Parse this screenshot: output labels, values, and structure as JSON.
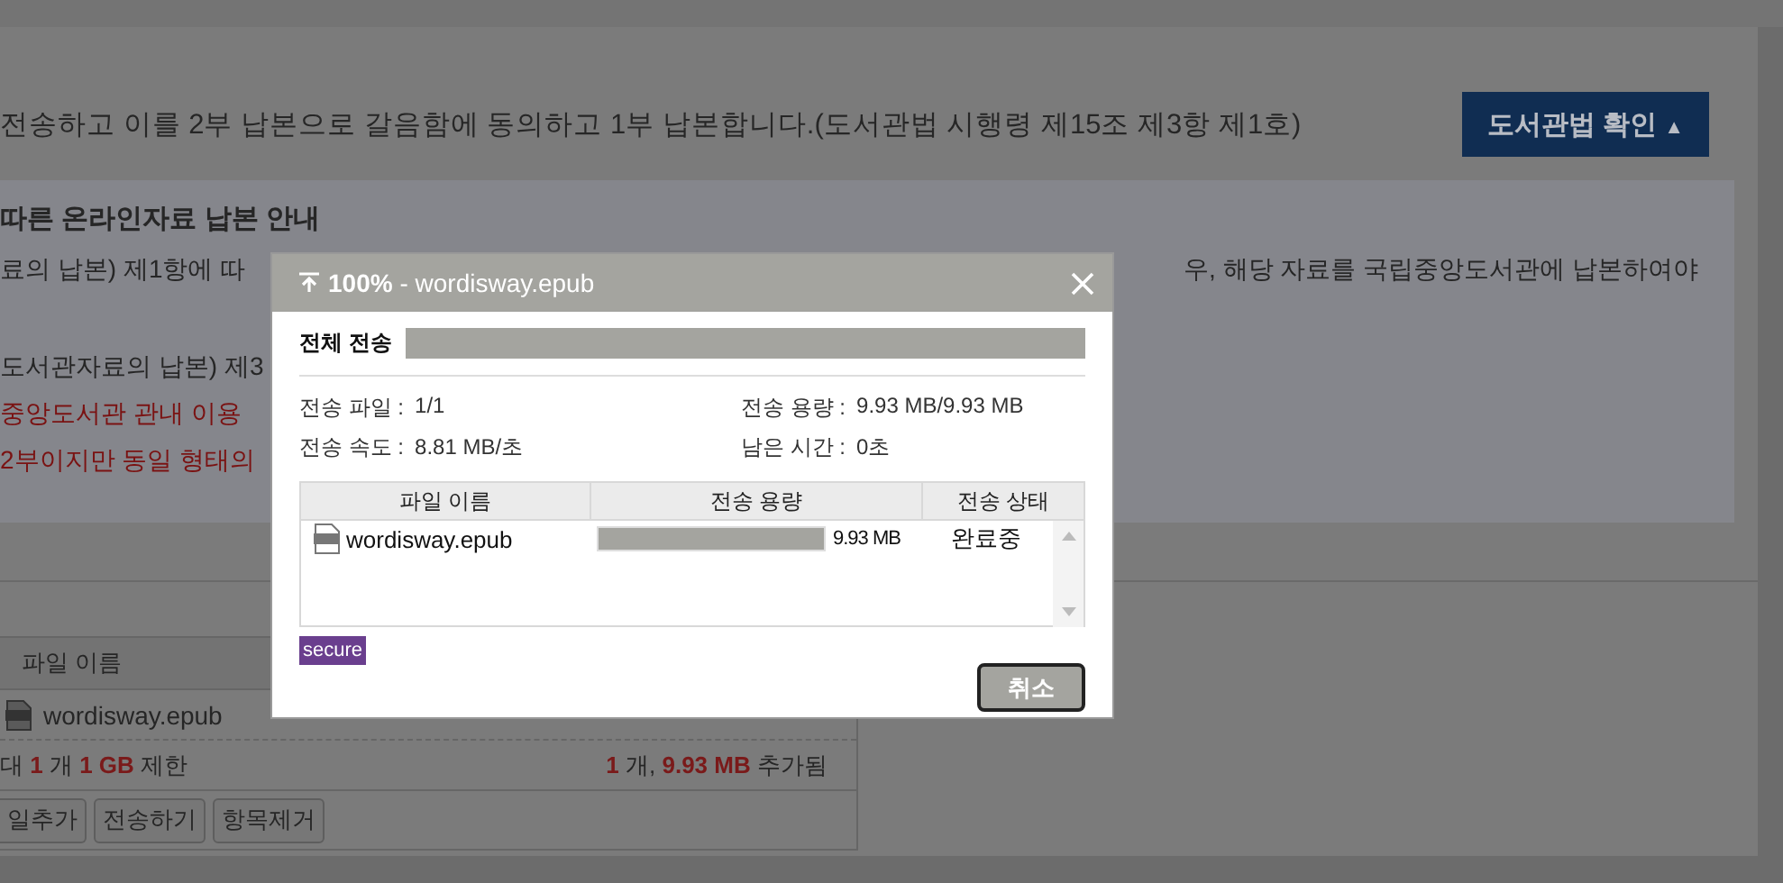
{
  "notice": {
    "text": "전송하고 이를 2부 납본으로 갈음함에 동의하고 1부 납본합니다.(도서관법 시행령 제15조 제3항 제1호)",
    "button": "도서관법 확인",
    "button_icon": "▲"
  },
  "guide": {
    "title": "따른 온라인자료 납본 안내",
    "lines": [
      {
        "kind": "normal",
        "left": "료의 납본) 제1항에 따",
        "right": "우, 해당 자료를 국립중앙도서관에 납본하여야"
      },
      {
        "kind": "gap"
      },
      {
        "kind": "normal",
        "left": "도서관자료의 납본) 제3"
      },
      {
        "kind": "alert",
        "left": "중앙도서관 관내 이용"
      },
      {
        "kind": "alert",
        "left": "2부이지만 동일 형태의"
      }
    ]
  },
  "file_panel": {
    "column": "파일 이름",
    "files": [
      {
        "name": "wordisway.epub"
      }
    ],
    "limit": "대 **1** 개 **1 GB** 제한",
    "added": "**1** 개, **9.93 MB** 추가됨",
    "buttons": [
      "일추가",
      "전송하기",
      "항목제거"
    ]
  },
  "dialog": {
    "title": "**100%** - wordisway.epub",
    "total_label": "전체 전송",
    "total_progress": {
      "level": 1
    },
    "stats": [
      {
        "label": "전송 파일 :",
        "value": "1/1"
      },
      {
        "label": "전송 용량 :",
        "value": "9.93 MB/9.93 MB"
      },
      {
        "label": "전송 속도 :",
        "value": "8.81 MB/초"
      },
      {
        "label": "남은 시간 :",
        "value": "0초"
      }
    ],
    "columns": [
      "파일 이름",
      "전송 용량",
      "전송 상태"
    ],
    "rows": [
      {
        "name": "wordisway.epub",
        "level": 1,
        "size": "9.93 MB",
        "status": "완료중"
      }
    ],
    "badge": "secure",
    "cancel": "취소"
  }
}
